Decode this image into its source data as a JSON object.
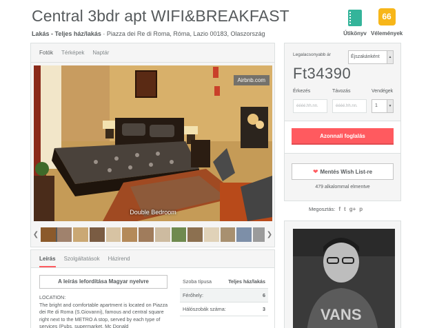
{
  "listing": {
    "title": "Central 3bdr apt WIFI&BREAKFAST",
    "type_bold": "Lakás - Teljes ház/lakás",
    "address": " · Piazza dei Re di Roma, Róma, Lazio 00183, Olaszország"
  },
  "header": {
    "guidebook_label": "Útikönyv",
    "reviews_count": "66",
    "reviews_label": "Vélemények"
  },
  "photos": {
    "tabs": [
      "Fotók",
      "Térképek",
      "Naptár"
    ],
    "active_tab": "Fotók",
    "badge": "Airbnb.com",
    "caption": "Double Bedroom",
    "thumbnail_colors": [
      "#8b5a2b",
      "#a0826d",
      "#caa874",
      "#7a5c43",
      "#d7c3a3",
      "#b48a5a",
      "#a07c5c",
      "#cdbba0",
      "#6f8a4f",
      "#8c7050",
      "#e0d2b8",
      "#a89070",
      "#7d8fa8",
      "#9b9b9b",
      "#b8a58c"
    ]
  },
  "description": {
    "tabs": [
      "Leírás",
      "Szolgáltatások",
      "Házirend"
    ],
    "active_tab": "Leírás",
    "translate_button": "A leírás lefordítása Magyar nyelvre",
    "location_label": "LOCATION:",
    "text": "The bright and comfortable apartment is located on Piazza dei Re di Roma (S.Giovanni), famous and central square right next to the METRO A stop, served by each type of services (Pubs, supermarket, Mc Donald"
  },
  "room_details": [
    {
      "label": "Szoba típusa",
      "value": "Teljes ház/lakás"
    },
    {
      "label": "Férőhely:",
      "value": "6"
    },
    {
      "label": "Hálószobák száma:",
      "value": "3"
    }
  ],
  "booking": {
    "price_label": "Legalacsonyabb ár",
    "price": "Ft34390",
    "per_period": "Éjszakánként",
    "checkin_label": "Érkezés",
    "checkout_label": "Távozás",
    "guests_label": "Vendégek",
    "checkin_placeholder": "éééé.hh.nn.",
    "checkout_placeholder": "éééé.hh.nn.",
    "guests_value": "1",
    "book_button": "Azonnali foglalás",
    "wishlist_button": "Mentés Wish List-re",
    "wishlist_count": "479 alkalommal elmentve"
  },
  "share": {
    "label": "Megosztás:",
    "icons": [
      "f",
      "t",
      "g+",
      "p"
    ]
  },
  "colors": {
    "accent": "#ff5a5f",
    "text": "#565a5c",
    "reviews_badge": "#f7b619",
    "guidebook": "#34b49a"
  }
}
